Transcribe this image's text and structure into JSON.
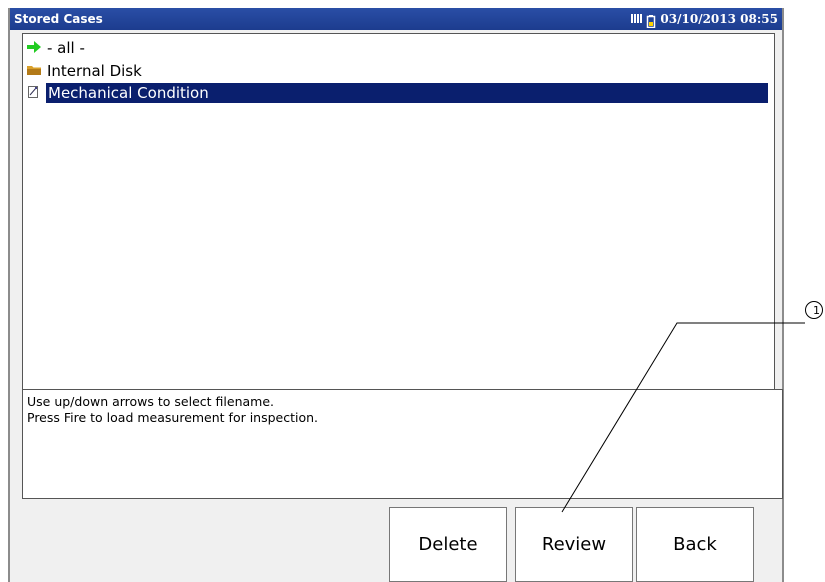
{
  "window": {
    "title": "Stored Cases",
    "datetime": "03/10/2013 08:55"
  },
  "status_icons": [
    "sd-card-icon",
    "battery-icon"
  ],
  "tree": {
    "items": [
      {
        "label": "- all -",
        "icon": "green-arrow-icon",
        "selected": false
      },
      {
        "label": "Internal Disk",
        "icon": "folder-icon",
        "selected": false
      },
      {
        "label": "Mechanical Condition",
        "icon": "document-icon",
        "selected": true
      }
    ]
  },
  "messages": [
    "Use up/down arrows to select filename.",
    "Press Fire to load measurement for inspection."
  ],
  "softkeys": {
    "delete": "Delete",
    "review": "Review",
    "back": "Back"
  },
  "callout": {
    "number": "1"
  },
  "colors": {
    "titlebar": "#1c3c8e",
    "selection": "#0a1f6e",
    "arrow": "#22cc22",
    "folder": "#d9a02a"
  }
}
